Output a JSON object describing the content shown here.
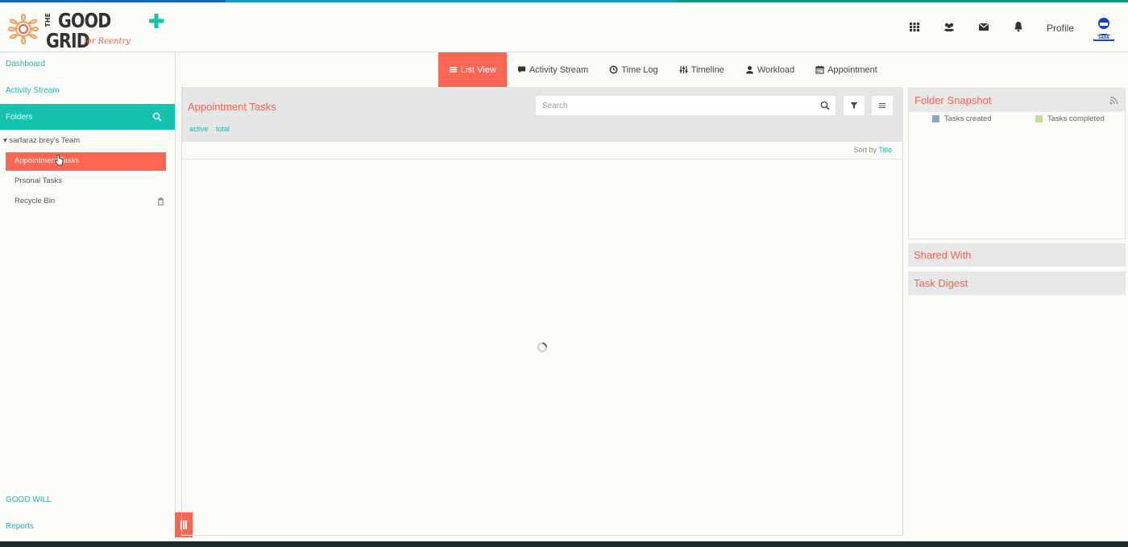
{
  "colors": {
    "accent_coral": "#fa6752",
    "accent_teal": "#15c2b0",
    "title_red": "#f26553",
    "link_teal": "#22b7b1",
    "stripe": [
      "#1a64ad",
      "#1a9ab9",
      "#11977d"
    ]
  },
  "header": {
    "logo": {
      "line1": "GOOD",
      "line2": "GRID",
      "prefix": "THE",
      "tagline": "for Reentry"
    },
    "add_icon": "plus-icon",
    "icons": [
      "apps-grid-icon",
      "users-icon",
      "mail-icon",
      "bell-icon"
    ],
    "profile_label": "Profile",
    "avatar_label": "SARA"
  },
  "sidebar": {
    "dashboard": "Dashboard",
    "activity_stream": "Activity Stream",
    "folders_label": "Folders",
    "team_name": "sarfaraz brey's Team",
    "folders": [
      {
        "label": "Appointment Tasks",
        "active": true
      },
      {
        "label": "Prsonal Tasks",
        "active": false
      },
      {
        "label": "Recycle Bin",
        "active": false
      }
    ],
    "good_will": "GOOD WILL",
    "reports": "Reports"
  },
  "tabs": [
    {
      "label": "List View",
      "icon": "list-icon",
      "active": true
    },
    {
      "label": "Activity Stream",
      "icon": "comment-icon",
      "active": false
    },
    {
      "label": "Time Log",
      "icon": "clock-icon",
      "active": false
    },
    {
      "label": "Timeline",
      "icon": "sliders-icon",
      "active": false
    },
    {
      "label": "Workload",
      "icon": "user-icon",
      "active": false
    },
    {
      "label": "Appointment",
      "icon": "calendar-icon",
      "active": false
    }
  ],
  "main": {
    "title": "Appointment Tasks",
    "filter_active": "active",
    "filter_total": "total",
    "search_placeholder": "Search",
    "sort_label": "Sort by",
    "sort_value": "Title"
  },
  "right": {
    "snapshot_title": "Folder Snapshot",
    "legend": [
      {
        "label": "Tasks created",
        "color": "#8ea7c9"
      },
      {
        "label": "Tasks completed",
        "color": "#c5e08a"
      }
    ],
    "shared_title": "Shared With",
    "digest_title": "Task Digest"
  }
}
